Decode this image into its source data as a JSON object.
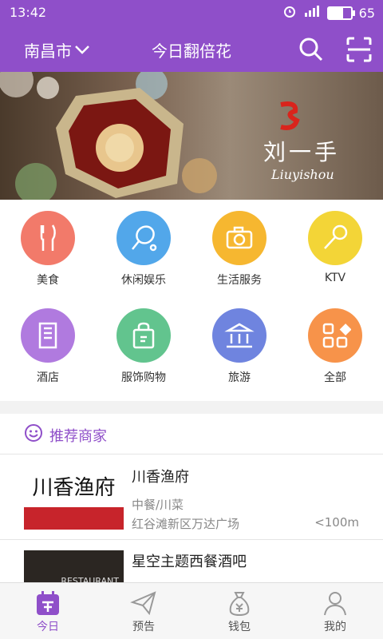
{
  "status": {
    "time": "13:42",
    "battery": "65"
  },
  "header": {
    "city": "南昌市",
    "title": "今日翻倍花"
  },
  "banner": {
    "brand_cn": "刘一手",
    "brand_en": "Liuyishou"
  },
  "categories": [
    {
      "label": "美食",
      "color": "#f27a6a",
      "icon": "fork-knife-icon"
    },
    {
      "label": "休闲娱乐",
      "color": "#52a7ea",
      "icon": "tennis-racket-icon"
    },
    {
      "label": "生活服务",
      "color": "#f6b730",
      "icon": "camera-icon"
    },
    {
      "label": "KTV",
      "color": "#f3d537",
      "icon": "microphone-icon"
    },
    {
      "label": "酒店",
      "color": "#b07adf",
      "icon": "building-icon"
    },
    {
      "label": "服饰购物",
      "color": "#62c48e",
      "icon": "shopping-bag-icon"
    },
    {
      "label": "旅游",
      "color": "#6f84df",
      "icon": "landmark-icon"
    },
    {
      "label": "全部",
      "color": "#f7934a",
      "icon": "grid-icon"
    }
  ],
  "recommend": {
    "title": "推荐商家",
    "merchants": [
      {
        "name": "川香渔府",
        "category": "中餐/川菜",
        "address": "红谷滩新区万达广场",
        "distance": "<100m",
        "thumb_text": "川香渔府"
      },
      {
        "name": "星空主题西餐酒吧",
        "category": "",
        "address": "",
        "distance": "",
        "thumb_text": "RESTAURANT"
      }
    ]
  },
  "tabs": [
    {
      "label": "今日",
      "icon": "today-icon",
      "active": true
    },
    {
      "label": "预告",
      "icon": "paper-plane-icon",
      "active": false
    },
    {
      "label": "钱包",
      "icon": "money-bag-icon",
      "active": false
    },
    {
      "label": "我的",
      "icon": "user-icon",
      "active": false
    }
  ],
  "colors": {
    "primary": "#8f4fc9"
  }
}
